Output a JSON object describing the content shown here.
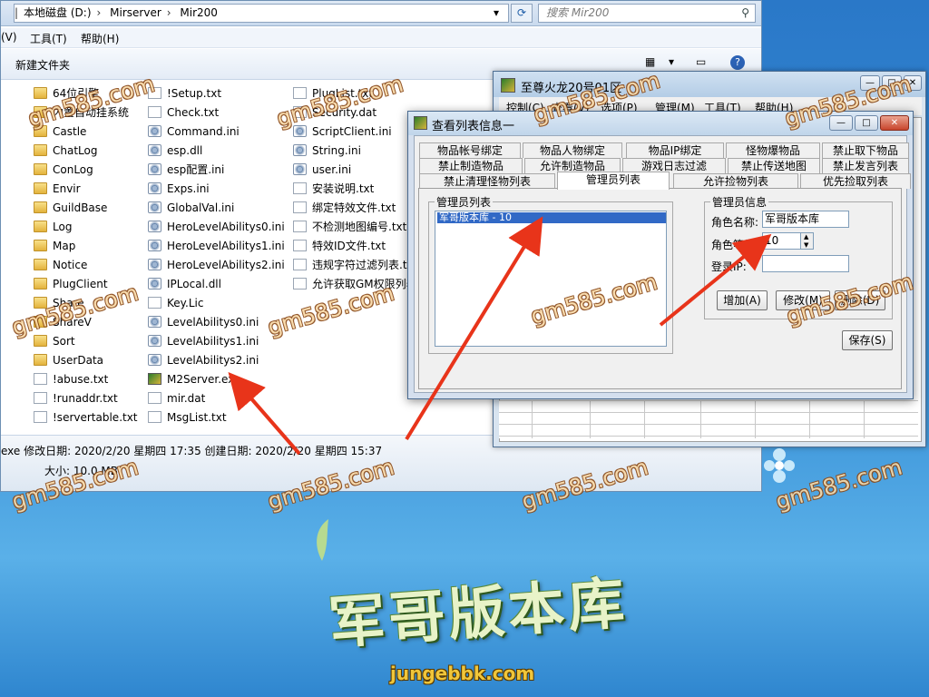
{
  "explorer": {
    "address": [
      "本地磁盘 (D:)",
      "Mirserver",
      "Mir200"
    ],
    "search_placeholder": "搜索 Mir200",
    "menu": [
      "(V)",
      "工具(T)",
      "帮助(H)"
    ],
    "new_folder": "新建文件夹",
    "col1": [
      {
        "n": "64位引擎",
        "t": "folder"
      },
      {
        "n": "内置自动挂系统",
        "t": "folder"
      },
      {
        "n": "Castle",
        "t": "folder"
      },
      {
        "n": "ChatLog",
        "t": "folder"
      },
      {
        "n": "ConLog",
        "t": "folder"
      },
      {
        "n": "Envir",
        "t": "folder"
      },
      {
        "n": "GuildBase",
        "t": "folder"
      },
      {
        "n": "Log",
        "t": "folder"
      },
      {
        "n": "Map",
        "t": "folder"
      },
      {
        "n": "Notice",
        "t": "folder"
      },
      {
        "n": "PlugClient",
        "t": "folder"
      },
      {
        "n": "Share",
        "t": "folder"
      },
      {
        "n": "ShareV",
        "t": "folder"
      },
      {
        "n": "Sort",
        "t": "folder"
      },
      {
        "n": "UserData",
        "t": "folder"
      },
      {
        "n": "!abuse.txt",
        "t": "file"
      },
      {
        "n": "!runaddr.txt",
        "t": "file"
      },
      {
        "n": "!servertable.txt",
        "t": "file"
      }
    ],
    "col2": [
      {
        "n": "!Setup.txt",
        "t": "file"
      },
      {
        "n": "Check.txt",
        "t": "file"
      },
      {
        "n": "Command.ini",
        "t": "gear"
      },
      {
        "n": "esp.dll",
        "t": "gear"
      },
      {
        "n": "esp配置.ini",
        "t": "gear"
      },
      {
        "n": "Exps.ini",
        "t": "gear"
      },
      {
        "n": "GlobalVal.ini",
        "t": "gear"
      },
      {
        "n": "HeroLevelAbilitys0.ini",
        "t": "gear"
      },
      {
        "n": "HeroLevelAbilitys1.ini",
        "t": "gear"
      },
      {
        "n": "HeroLevelAbilitys2.ini",
        "t": "gear"
      },
      {
        "n": "IPLocal.dll",
        "t": "gear"
      },
      {
        "n": "Key.Lic",
        "t": "file"
      },
      {
        "n": "LevelAbilitys0.ini",
        "t": "gear"
      },
      {
        "n": "LevelAbilitys1.ini",
        "t": "gear"
      },
      {
        "n": "LevelAbilitys2.ini",
        "t": "gear"
      },
      {
        "n": "M2Server.exe",
        "t": "exe"
      },
      {
        "n": "mir.dat",
        "t": "file"
      },
      {
        "n": "MsgList.txt",
        "t": "file"
      }
    ],
    "col3": [
      {
        "n": "PlugList.txt",
        "t": "file"
      },
      {
        "n": "Security.dat",
        "t": "file"
      },
      {
        "n": "ScriptClient.ini",
        "t": "gear"
      },
      {
        "n": "String.ini",
        "t": "gear"
      },
      {
        "n": "user.ini",
        "t": "gear"
      },
      {
        "n": "安装说明.txt",
        "t": "file"
      },
      {
        "n": "绑定特效文件.txt",
        "t": "file"
      },
      {
        "n": "不检测地图编号.txt",
        "t": "file"
      },
      {
        "n": "特效ID文件.txt",
        "t": "file"
      },
      {
        "n": "违规字符过滤列表.txt",
        "t": "file"
      },
      {
        "n": "允许获取GM权限列表",
        "t": "file"
      }
    ],
    "status_line1": "exe  修改日期: 2020/2/20 星期四 17:35  创建日期: 2020/2/20 星期四 15:37",
    "status_line2": "大小: 10.0 MB"
  },
  "mainwin": {
    "title": "至尊火龙20号01区",
    "menu": [
      "控制(C)",
      "查看(V)",
      "选项(P)",
      "管理(M)",
      "工具(T)",
      "帮助(H)"
    ]
  },
  "dialog": {
    "title": "查看列表信息一",
    "tabs_row1": [
      "物品帐号绑定",
      "物品人物绑定",
      "物品IP绑定",
      "怪物爆物品",
      "禁止取下物品"
    ],
    "tabs_row2": [
      "禁止制造物品",
      "允许制造物品",
      "游戏日志过滤",
      "禁止传送地图",
      "禁止发言列表"
    ],
    "tabs_row3": [
      "禁止清理怪物列表",
      "管理员列表",
      "允许捡物列表",
      "优先捡取列表"
    ],
    "admin_list_label": "管理员列表",
    "admin_items": [
      "军哥版本库 - 10"
    ],
    "admin_info_label": "管理员信息",
    "name_label": "角色名称:",
    "name_value": "军哥版本库",
    "level_label": "角色等级:",
    "level_value": "10",
    "login_label": "登录IP:",
    "login_value": "",
    "add_btn": "增加(A)",
    "edit_btn": "修改(M)",
    "delete_btn": "删除(D)",
    "save_btn": "保存(S)"
  },
  "watermark": "gm585.com",
  "logo": {
    "text": "军哥版本库",
    "url": "jungebbk.com"
  }
}
